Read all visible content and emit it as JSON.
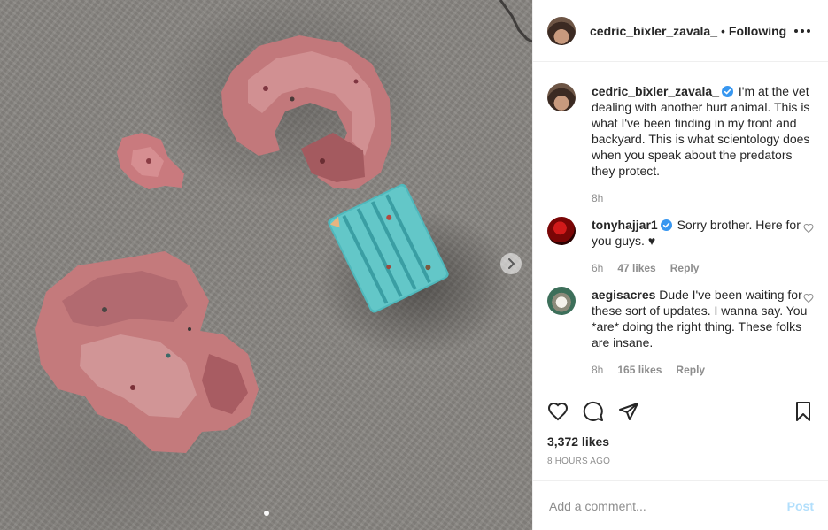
{
  "header": {
    "username": "cedric_bixler_zavala_",
    "separator": "•",
    "follow_label": "Following"
  },
  "media": {
    "slide_count": 1,
    "current_slide": 1
  },
  "caption": {
    "username": "cedric_bixler_zavala_",
    "text": "I'm at the vet dealing with another hurt animal. This is what I've been finding in my front and backyard. This is what scientology does when you speak about the predators they protect.",
    "time": "8h"
  },
  "comments": [
    {
      "username": "tonyhajjar1",
      "verified": true,
      "text": "Sorry brother. Here for you guys. ♥",
      "time": "6h",
      "likes": "47 likes",
      "reply_label": "Reply"
    },
    {
      "username": "aegisacres",
      "verified": false,
      "text": "Dude I've been waiting for these sort of updates. I wanna say. You *are* doing the right thing. These folks are insane.",
      "time": "8h",
      "likes": "165 likes",
      "reply_label": "Reply"
    }
  ],
  "footer": {
    "likes": "3,372 likes",
    "timestamp": "8 HOURS AGO",
    "comment_placeholder": "Add a comment...",
    "post_label": "Post"
  },
  "colors": {
    "text": "#262626",
    "secondary": "#8e8e8e",
    "verified": "#3897f0",
    "post_disabled": "#b2dffc"
  }
}
